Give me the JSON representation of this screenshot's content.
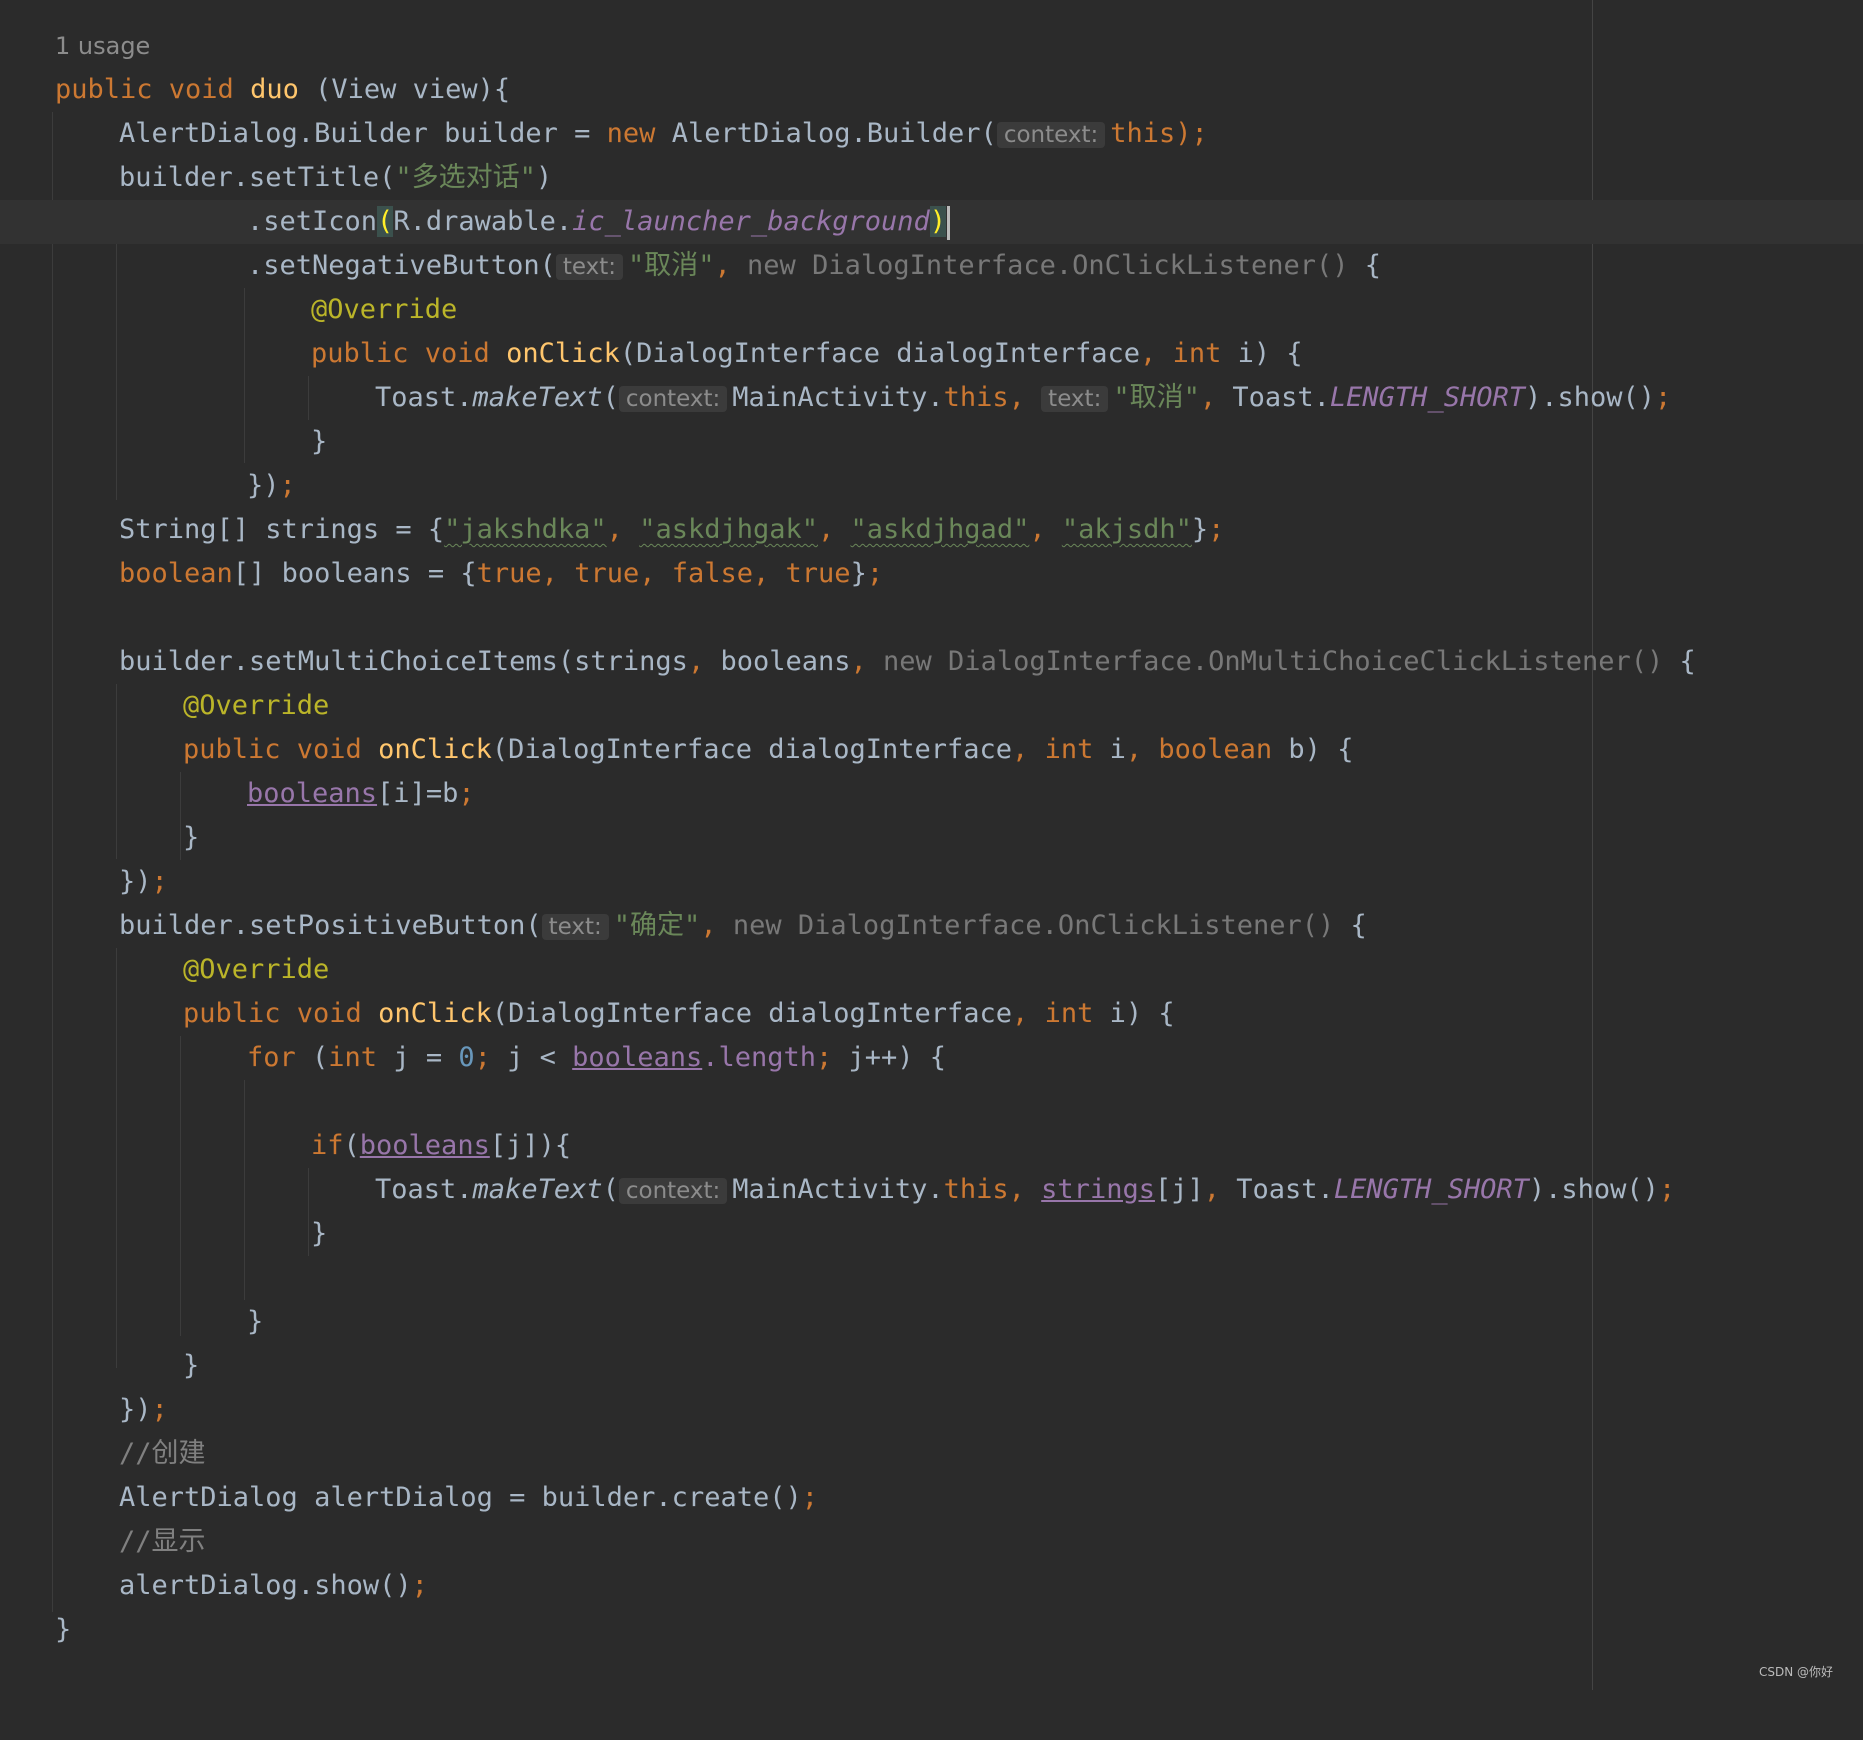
{
  "editor": {
    "theme": {
      "background": "#2b2b2b",
      "keyword": "#cc7832",
      "function": "#ffc66d",
      "string": "#6a8759",
      "annotation": "#bbb529",
      "number": "#6897bb",
      "field": "#9876aa",
      "comment": "#808080",
      "text": "#a9b7c6"
    },
    "usage_hint": "1 usage",
    "lines": {
      "l1": {
        "kw1": "public void ",
        "fn": "duo",
        "rest": " (View view){"
      },
      "l2": {
        "a": "AlertDialog.Builder builder = ",
        "kw": "new",
        "b": " AlertDialog.Builder(",
        "hint": "context:",
        "c": "this",
        "d": ");"
      },
      "l3": {
        "a": "builder.setTitle(",
        "str": "\"多选对话\"",
        "b": ")"
      },
      "l4": {
        "a": ".setIcon",
        "lp": "(",
        "b": "R.drawable.",
        "fld": "ic_launcher_background",
        "rp": ")"
      },
      "l5": {
        "a": ".setNegativeButton(",
        "hint": "text:",
        "str": "\"取消\"",
        "comma": ", ",
        "dim": "new DialogInterface.OnClickListener()",
        "b": " {"
      },
      "l6": {
        "ann": "@Override"
      },
      "l7": {
        "kw": "public void ",
        "fn": "onClick",
        "a": "(DialogInterface dialogInterface",
        "c1": ", ",
        "kw2": "int",
        "b": " i) {"
      },
      "l8": {
        "a": "Toast.",
        "it": "makeText",
        "b": "(",
        "hint1": "context:",
        "c": "MainActivity.",
        "kw": "this",
        "c1": ", ",
        "hint2": "text:",
        "str": "\"取消\"",
        "c2": ", ",
        "d": "Toast.",
        "fld": "LENGTH_SHORT",
        "e": ").show()",
        "semi": ";"
      },
      "l9": {
        "a": "}"
      },
      "l10": {
        "a": "})",
        "semi": ";"
      },
      "l11": {
        "a": "String[] strings = {",
        "s1": "\"jakshdka\"",
        "c1": ", ",
        "s2": "\"askdjhgak\"",
        "c2": ", ",
        "s3": "\"askdjhgad\"",
        "c3": ", ",
        "s4": "\"akjsdh\"",
        "b": "}",
        "semi": ";"
      },
      "l12": {
        "kw": "boolean",
        "a": "[] booleans = {",
        "t1": "true",
        "c1": ", ",
        "t2": "true",
        "c2": ", ",
        "t3": "false",
        "c3": ", ",
        "t4": "true",
        "b": "}",
        "semi": ";"
      },
      "l13": {
        "a": "builder.setMultiChoiceItems(strings",
        "c1": ", ",
        "b": "booleans",
        "c2": ", ",
        "dim": "new DialogInterface.OnMultiChoiceClickListener()",
        "d": " {"
      },
      "l14": {
        "ann": "@Override"
      },
      "l15": {
        "kw": "public void ",
        "fn": "onClick",
        "a": "(DialogInterface dialogInterface",
        "c1": ", ",
        "kw2": "int",
        "b": " i",
        "c2": ", ",
        "kw3": "boolean",
        "d": " b) {"
      },
      "l16": {
        "ul": "booleans",
        "a": "[i]=b",
        "semi": ";"
      },
      "l17": {
        "a": "}"
      },
      "l18": {
        "a": "})",
        "semi": ";"
      },
      "l19": {
        "a": "builder.setPositiveButton(",
        "hint": "text:",
        "str": "\"确定\"",
        "comma": ", ",
        "dim": "new DialogInterface.OnClickListener()",
        "b": " {"
      },
      "l20": {
        "ann": "@Override"
      },
      "l21": {
        "kw": "public void ",
        "fn": "onClick",
        "a": "(DialogInterface dialogInterface",
        "c1": ", ",
        "kw2": "int",
        "b": " i) {"
      },
      "l22": {
        "kw": "for",
        "a": " (",
        "kw2": "int",
        "b": " j = ",
        "num": "0",
        "s1": "; ",
        "c": "j < ",
        "ul": "booleans",
        "d": ".length",
        "s2": "; ",
        "e": "j++) {"
      },
      "l23": {
        "kw": "if",
        "a": "(",
        "ul": "booleans",
        "b": "[j]){"
      },
      "l24": {
        "a": "Toast.",
        "it": "makeText",
        "b": "(",
        "hint": "context:",
        "c": "MainActivity.",
        "kw": "this",
        "c1": ", ",
        "ul": "strings",
        "d": "[j]",
        "c2": ", ",
        "e": "Toast.",
        "fld": "LENGTH_SHORT",
        "f": ").show()",
        "semi": ";"
      },
      "l25": {
        "a": "}"
      },
      "l26": {
        "a": "}"
      },
      "l27": {
        "a": "}"
      },
      "l28": {
        "a": "})",
        "semi": ";"
      },
      "l29": {
        "cmt": "//创建"
      },
      "l30": {
        "a": "AlertDialog alertDialog = builder.create()",
        "semi": ";"
      },
      "l31": {
        "cmt": "//显示"
      },
      "l32": {
        "a": "alertDialog.show()",
        "semi": ";"
      },
      "l33": {
        "a": "}"
      }
    }
  },
  "watermark": "CSDN @你好"
}
